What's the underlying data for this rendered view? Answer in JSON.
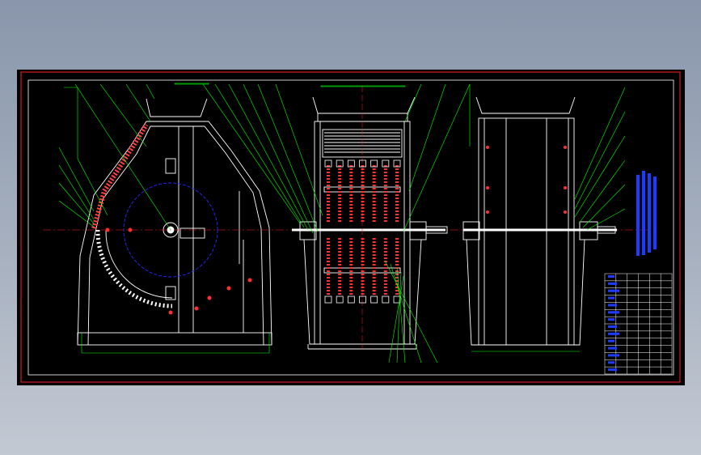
{
  "drawing": {
    "description_label": "",
    "colors": {
      "background": "#000000",
      "frame": "#ff2020",
      "outline": "#ffffff",
      "leader": "#00ff00",
      "rotor_circle": "#2828ff",
      "centerline": "#ff2020",
      "dimension": "#00ff00",
      "title_text": "#1e3cff"
    },
    "views": [
      {
        "id": "side-view",
        "kind": "section"
      },
      {
        "id": "front-view",
        "kind": "section"
      },
      {
        "id": "end-view",
        "kind": "elevation"
      }
    ],
    "hammer_columns_upper": 7,
    "hammer_columns_lower": 7,
    "title_block": {
      "rows": 14,
      "cols": 6
    }
  }
}
